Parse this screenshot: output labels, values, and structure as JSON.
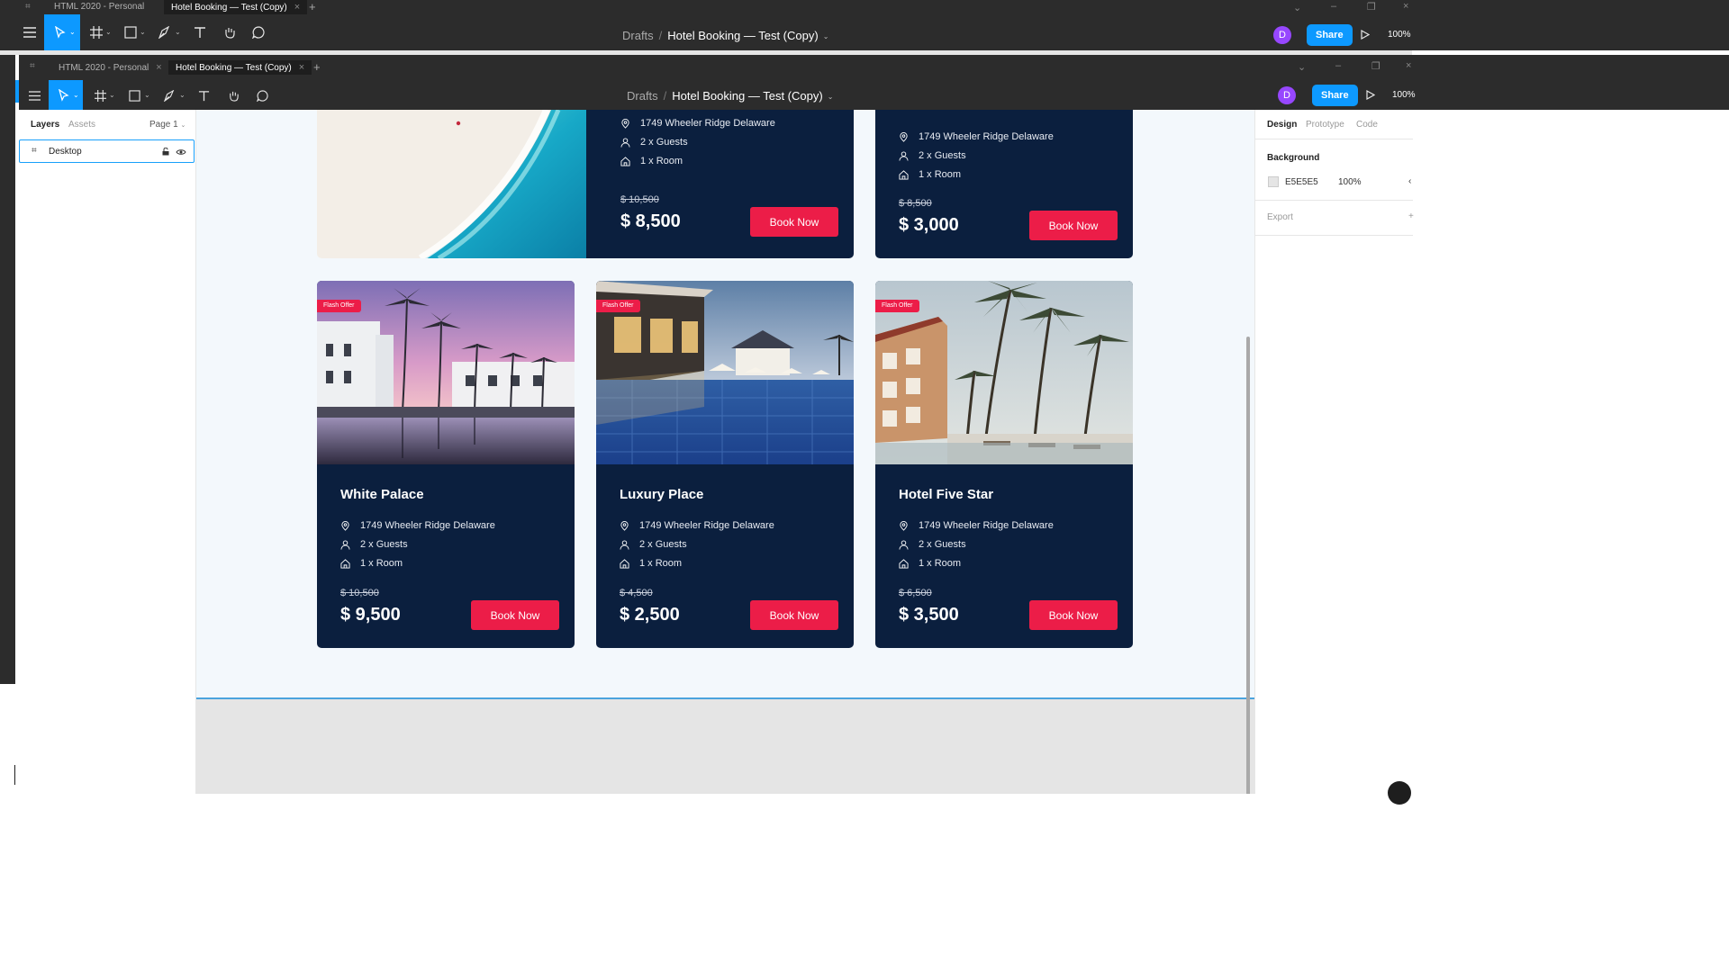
{
  "outer_window": {
    "tabs": [
      {
        "label": "HTML 2020 - Personal"
      },
      {
        "label": "Hotel Booking — Test (Copy)"
      }
    ],
    "breadcrumb": {
      "root": "Drafts",
      "separator": "/",
      "file": "Hotel Booking — Test (Copy)"
    },
    "avatar_initial": "D",
    "share_label": "Share",
    "zoom": "100%"
  },
  "inner_window": {
    "tabs": [
      {
        "label": "HTML 2020 - Personal"
      },
      {
        "label": "Hotel Booking — Test (Copy)"
      }
    ],
    "breadcrumb": {
      "root": "Drafts",
      "separator": "/",
      "file": "Hotel Booking — Test (Copy)"
    },
    "avatar_initial": "D",
    "share_label": "Share",
    "zoom": "100%"
  },
  "left_panel": {
    "tabs": [
      "Layers",
      "Assets"
    ],
    "page_selector": "Page 1",
    "layers": [
      {
        "name": "Desktop"
      }
    ]
  },
  "right_panel": {
    "tabs": [
      "Design",
      "Prototype",
      "Code"
    ],
    "background_title": "Background",
    "background_hex": "E5E5E5",
    "background_opacity": "100%",
    "export_title": "Export",
    "swatch_color": "#e5e5e5"
  },
  "colors": {
    "accent": "#0d99ff",
    "card_bg": "#0b1f3e",
    "book_button": "#ec1d48",
    "frame_bg": "#f3f8fc",
    "canvas_bg": "#e5e5e5"
  },
  "top_cards": [
    {
      "address": "1749 Wheeler Ridge  Delaware",
      "guests": "2 x Guests",
      "rooms": "1 x Room",
      "old_price": "$ 10,500",
      "price": "$ 8,500",
      "button": "Book Now"
    },
    {
      "address": "1749 Wheeler Ridge  Delaware",
      "guests": "2 x Guests",
      "rooms": "1 x Room",
      "old_price": "$ 8,500",
      "price": "$ 3,000",
      "button": "Book Now"
    }
  ],
  "cards": [
    {
      "badge": "Flash Offer",
      "name": "White Palace",
      "address": "1749 Wheeler Ridge  Delaware",
      "guests": "2 x Guests",
      "rooms": "1 x Room",
      "old_price": "$ 10,500",
      "price": "$ 9,500",
      "button": "Book Now"
    },
    {
      "badge": "Flash Offer",
      "name": "Luxury Place",
      "address": "1749 Wheeler Ridge  Delaware",
      "guests": "2 x Guests",
      "rooms": "1 x Room",
      "old_price": "$ 4,500",
      "price": "$ 2,500",
      "button": "Book Now"
    },
    {
      "badge": "Flash Offer",
      "name": "Hotel Five Star",
      "address": "1749 Wheeler Ridge  Delaware",
      "guests": "2 x Guests",
      "rooms": "1 x Room",
      "old_price": "$ 6,500",
      "price": "$ 3,500",
      "button": "Book Now"
    }
  ]
}
